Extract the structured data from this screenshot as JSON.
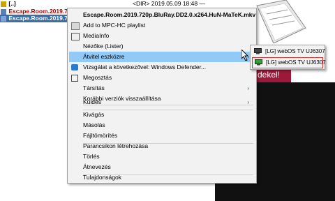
{
  "file_list": {
    "rows": [
      {
        "name": "[..]",
        "color": "#000000"
      },
      {
        "name": "Escape.Room.2019.720",
        "color": "#b00000"
      },
      {
        "name": "Escape.Room.2019.720",
        "color": "#000000"
      }
    ],
    "dir_line": "<DIR>     2019.05.09 18:48 —"
  },
  "banner_text": "dekel!",
  "context_menu": {
    "title": "Escape.Room.2019.720p.BluRay.DD2.0.x264.HuN-MaTeK.mkv",
    "items": [
      {
        "label": "Add to MPC-HC playlist",
        "icon": "mpc-icon"
      },
      {
        "label": "MediaInfo",
        "icon": "mediainfo-icon"
      },
      {
        "label": "Nézőke (Lister)",
        "icon": ""
      },
      {
        "label": "Átvitel eszközre",
        "icon": "",
        "highlighted": true,
        "submenu": true
      },
      {
        "label": "Vizsgálat a következővel: Windows Defender...",
        "icon": "defender-icon"
      },
      {
        "label": "Megosztás",
        "icon": "share-icon"
      },
      {
        "label": "Társítás",
        "icon": "",
        "submenu": true
      },
      {
        "label": "Korábbi verziók visszaállítása",
        "icon": ""
      },
      {
        "label": "Küldés",
        "icon": "",
        "submenu": true
      },
      {
        "label": "Kivágás",
        "icon": ""
      },
      {
        "label": "Másolás",
        "icon": ""
      },
      {
        "label": "Fájltömörítés",
        "icon": ""
      },
      {
        "label": "Parancsikon létrehozása",
        "icon": ""
      },
      {
        "label": "Törlés",
        "icon": ""
      },
      {
        "label": "Átnevezés",
        "icon": ""
      },
      {
        "label": "Tulajdonságok",
        "icon": ""
      }
    ],
    "submenu_arrow": "›"
  },
  "cast_submenu": {
    "items": [
      {
        "label": "[LG] webOS TV UJ6307",
        "icon": "tv-icon"
      },
      {
        "label": "[LG] webOS TV UJ6307",
        "icon": "tv-icon",
        "outlined": true
      }
    ]
  },
  "colors": {
    "highlight": "#91c9f7",
    "outline": "#d93030",
    "banner": "#9b1a3a"
  }
}
